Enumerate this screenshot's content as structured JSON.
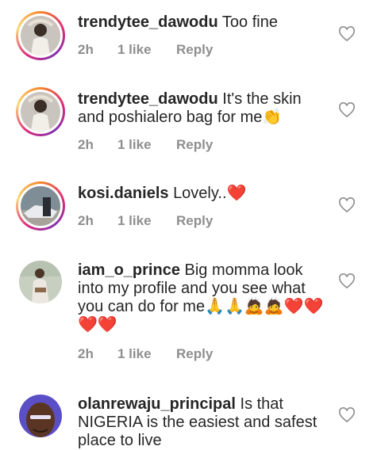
{
  "comments": [
    {
      "username": "trendytee_dawodu",
      "text": "Too fine",
      "time": "2h",
      "likes": "1 like",
      "reply": "Reply"
    },
    {
      "username": "trendytee_dawodu",
      "text": "It's the skin and poshialero bag for me👏",
      "time": "2h",
      "likes": "1 like",
      "reply": "Reply"
    },
    {
      "username": "kosi.daniels",
      "text": "Lovely..❤️",
      "time": "2h",
      "likes": "1 like",
      "reply": "Reply"
    },
    {
      "username": "iam_o_prince",
      "text": "Big momma look into my profile and  you see what you can do for me🙏🙏🙇🙇❤️❤️❤️❤️",
      "time": "2h",
      "likes": "1 like",
      "reply": "Reply"
    },
    {
      "username": "olanrewaju_principal",
      "text": "Is that NIGERIA is the easiest and safest place to live",
      "time": "",
      "likes": "",
      "reply": ""
    }
  ],
  "colors": {
    "username": "#262626",
    "meta": "#8e8e8e",
    "heart_outline": "#8e8e8e",
    "story_ring": "#dd2a7b"
  }
}
